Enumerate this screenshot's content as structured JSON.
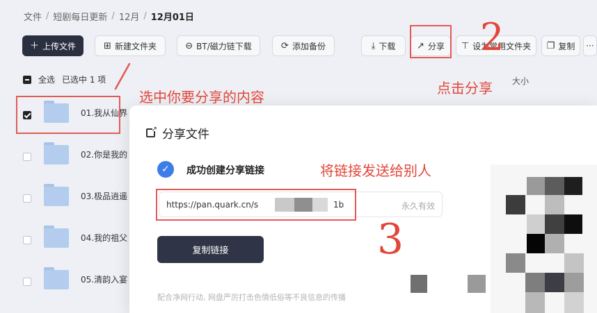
{
  "breadcrumb": {
    "items": [
      "文件",
      "短剧每日更新",
      "12月"
    ],
    "current": "12月01日"
  },
  "toolbar": {
    "upload": "上传文件",
    "new_folder": "新建文件夹",
    "bt": "BT/磁力链下载",
    "backup": "添加备份",
    "download": "下载",
    "share": "分享",
    "set_common": "设为常用文件夹",
    "copy": "复制",
    "more": "···"
  },
  "list_header": {
    "select_all": "全选",
    "selected_count": "已选中 1 项",
    "size_col": "大小"
  },
  "files": [
    {
      "name": "01.我从仙界",
      "checked": true
    },
    {
      "name": "02.你是我的",
      "checked": false
    },
    {
      "name": "03.极品逍遥",
      "checked": false
    },
    {
      "name": "04.我的祖父",
      "checked": false
    },
    {
      "name": "05.清韵入宴",
      "checked": false
    }
  ],
  "annotations": {
    "select_tip": "选中你要分享的内容",
    "click_share": "点击分享",
    "send_link": "将链接发送给别人",
    "num2": "2",
    "num3": "3"
  },
  "share_dialog": {
    "title": "分享文件",
    "success": "成功创建分享链接",
    "url_prefix": "https://pan.quark.cn/s",
    "url_tail": "1b",
    "validity": "永久有效",
    "copy_button": "复制链接",
    "note": "配合净网行动, 网盘严厉打击色情低俗等不良信息的传播"
  },
  "colors": {
    "primary_dark": "#2b3040",
    "annotation_red": "#e2463a",
    "check_blue": "#3c7de8"
  }
}
